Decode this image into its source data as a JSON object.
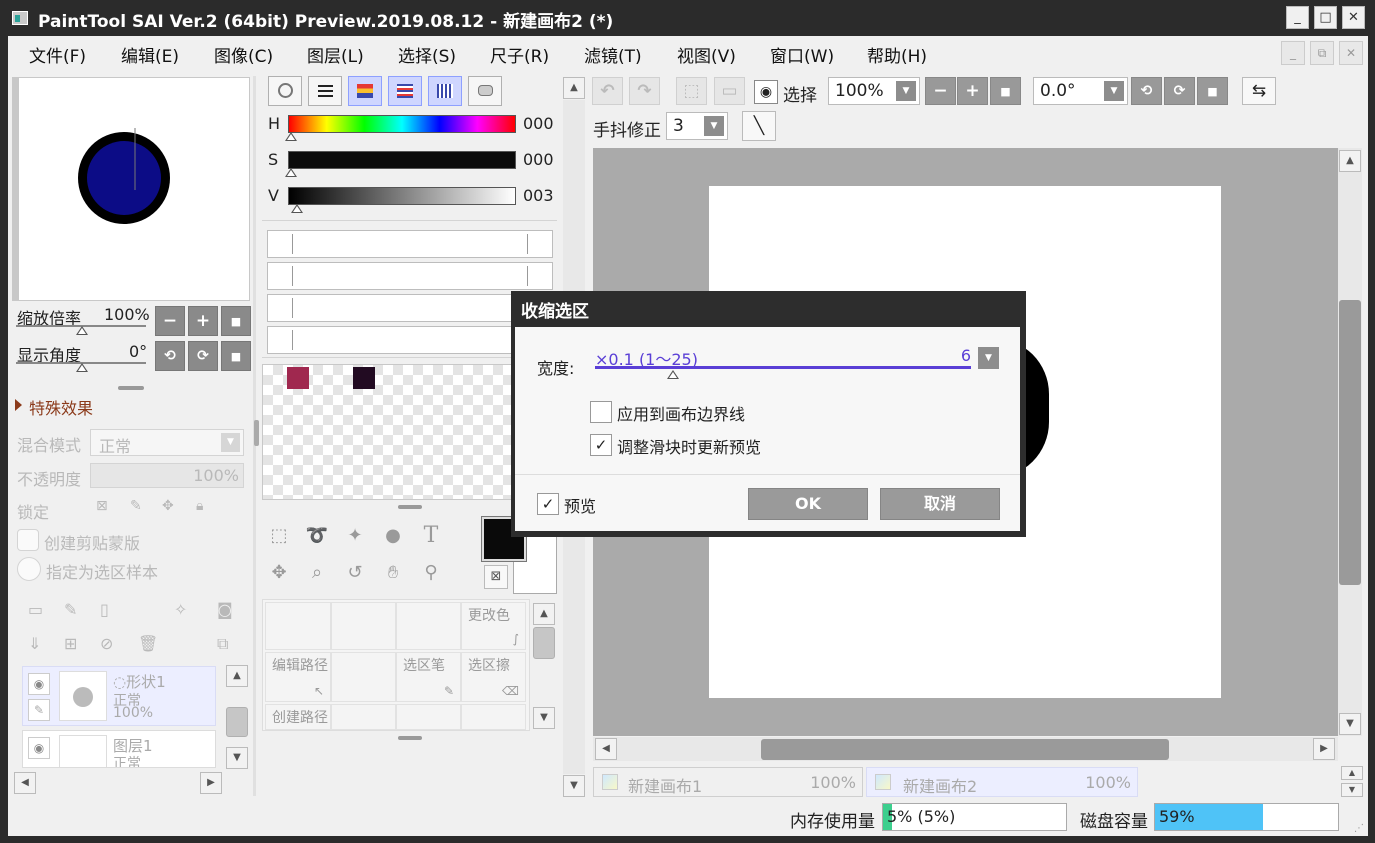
{
  "window": {
    "title": "PaintTool SAI Ver.2 (64bit) Preview.2019.08.12 - 新建画布2 (*)",
    "minimize": "_",
    "maximize": "□",
    "close": "✕"
  },
  "menu": {
    "items": [
      "文件(F)",
      "编辑(E)",
      "图像(C)",
      "图层(L)",
      "选择(S)",
      "尺子(R)",
      "滤镜(T)",
      "视图(V)",
      "窗口(W)",
      "帮助(H)"
    ]
  },
  "navigator": {
    "zoom_label": "缩放倍率",
    "zoom_value": "100%",
    "angle_label": "显示角度",
    "angle_value": "0°",
    "minus": "−",
    "plus": "+",
    "reset": "■"
  },
  "layer_panel": {
    "effects_label": "特殊效果",
    "blend_label": "混合模式",
    "blend_value": "正常",
    "opacity_label": "不透明度",
    "opacity_value": "100%",
    "lock_label": "锁定",
    "clip_label": "创建剪贴蒙版",
    "sample_label": "指定为选区样本",
    "layers": [
      {
        "name": "形状1",
        "mode": "正常",
        "opacity": "100%"
      },
      {
        "name": "图层1",
        "mode": "正常"
      }
    ]
  },
  "color_panel": {
    "h_label": "H",
    "h_value": "000",
    "s_label": "S",
    "s_value": "000",
    "v_label": "V",
    "v_value": "003",
    "swatches": [
      "#a0284f",
      "#220b22"
    ]
  },
  "tools": {
    "text_tool": "T",
    "brushes": {
      "change_color": "更改色",
      "edit_path": "编辑路径",
      "select_pen": "选区笔",
      "select_eraser": "选区擦",
      "create_path": "创建路径"
    }
  },
  "toolbar": {
    "select_label": "选择",
    "zoom_value": "100%",
    "angle_value": "0.0°",
    "stabilizer_label": "手抖修正",
    "stabilizer_value": "3"
  },
  "dialog": {
    "title": "收缩选区",
    "width_label": "宽度:",
    "width_unit": "×0.1 (1～25)",
    "width_value": "6",
    "width_fraction": 0.208,
    "apply_border_label": "应用到画布边界线",
    "apply_border_checked": false,
    "update_preview_label": "调整滑块时更新预览",
    "update_preview_checked": true,
    "preview_label": "预览",
    "preview_checked": true,
    "ok_label": "OK",
    "cancel_label": "取消",
    "check_mark": "✓"
  },
  "tabs": [
    {
      "name": "新建画布1",
      "zoom": "100%"
    },
    {
      "name": "新建画布2",
      "zoom": "100%"
    }
  ],
  "status": {
    "memory_label": "内存使用量",
    "memory_value": "5% (5%)",
    "memory_fraction": 0.05,
    "disk_label": "磁盘容量",
    "disk_value": "59%",
    "disk_fraction": 0.59
  },
  "colors": {
    "accent": "#5a3fd6",
    "disk_bar": "#4fc3f7",
    "memory_bar": "#3ccf8e",
    "effects_arrow": "#8b3a1a"
  }
}
